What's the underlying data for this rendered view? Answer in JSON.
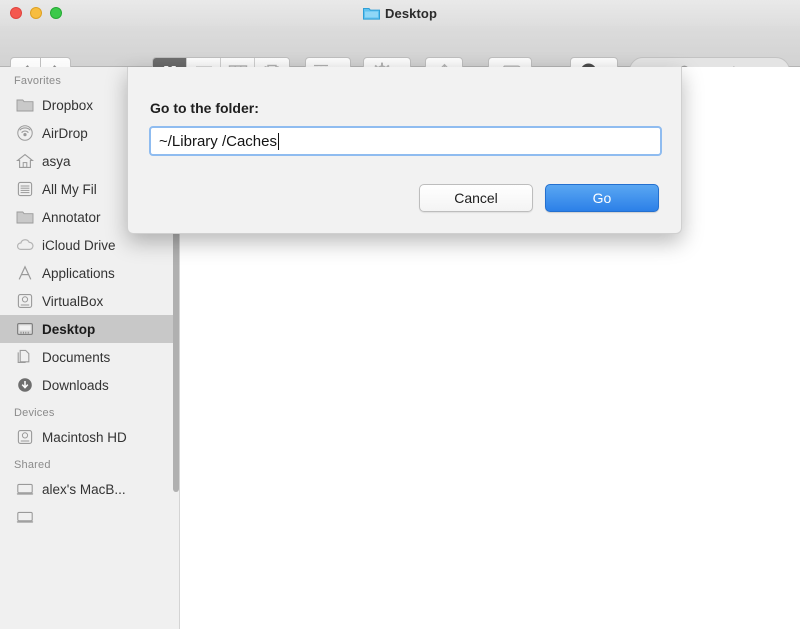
{
  "window": {
    "title": "Desktop",
    "title_icon": "blue-folder-icon",
    "traffic_lights": [
      {
        "name": "close",
        "color": "#f4584f"
      },
      {
        "name": "minimize",
        "color": "#f7bd3f"
      },
      {
        "name": "maximize",
        "color": "#3bc94a"
      }
    ]
  },
  "toolbar": {
    "back_label": "Back",
    "forward_label": "Forward",
    "view_modes": [
      {
        "name": "icon-view",
        "selected": true
      },
      {
        "name": "list-view",
        "selected": false
      },
      {
        "name": "column-view",
        "selected": false
      },
      {
        "name": "coverflow-view",
        "selected": false
      }
    ],
    "arrange_label": "Arrange",
    "action_label": "Action",
    "share_label": "Share",
    "tag_label": "Tags",
    "dropbox_label": "Dropbox"
  },
  "search": {
    "placeholder": "Search",
    "value": ""
  },
  "sidebar": {
    "groups": [
      {
        "header": "Favorites",
        "items": [
          {
            "label": "Dropbox",
            "icon": "folder-icon",
            "selected": false
          },
          {
            "label": "AirDrop",
            "icon": "airdrop-icon",
            "selected": false
          },
          {
            "label": "asya",
            "icon": "home-icon",
            "selected": false
          },
          {
            "label": "All My Fil",
            "icon": "all-my-files-icon",
            "selected": false
          },
          {
            "label": "Annotator",
            "icon": "folder-icon",
            "selected": false
          },
          {
            "label": "iCloud Drive",
            "icon": "cloud-icon",
            "selected": false
          },
          {
            "label": "Applications",
            "icon": "applications-icon",
            "selected": false
          },
          {
            "label": "VirtualBox",
            "icon": "disk-icon",
            "selected": false
          },
          {
            "label": "Desktop",
            "icon": "desktop-icon",
            "selected": true
          },
          {
            "label": "Documents",
            "icon": "documents-icon",
            "selected": false
          },
          {
            "label": "Downloads",
            "icon": "downloads-icon",
            "selected": false
          }
        ]
      },
      {
        "header": "Devices",
        "items": [
          {
            "label": "Macintosh HD",
            "icon": "disk-icon",
            "selected": false
          }
        ]
      },
      {
        "header": "Shared",
        "items": [
          {
            "label": "alex's MacB...",
            "icon": "screen-icon",
            "selected": false
          },
          {
            "label": "",
            "icon": "screen-icon",
            "selected": false
          }
        ]
      }
    ]
  },
  "sheet": {
    "label": "Go to the folder:",
    "input_value": "~/Library /Caches",
    "input_placeholder": "",
    "cancel_label": "Cancel",
    "go_label": "Go",
    "accent_color": "#2c80e8",
    "focus_ring_color": "#8fbcf0"
  }
}
